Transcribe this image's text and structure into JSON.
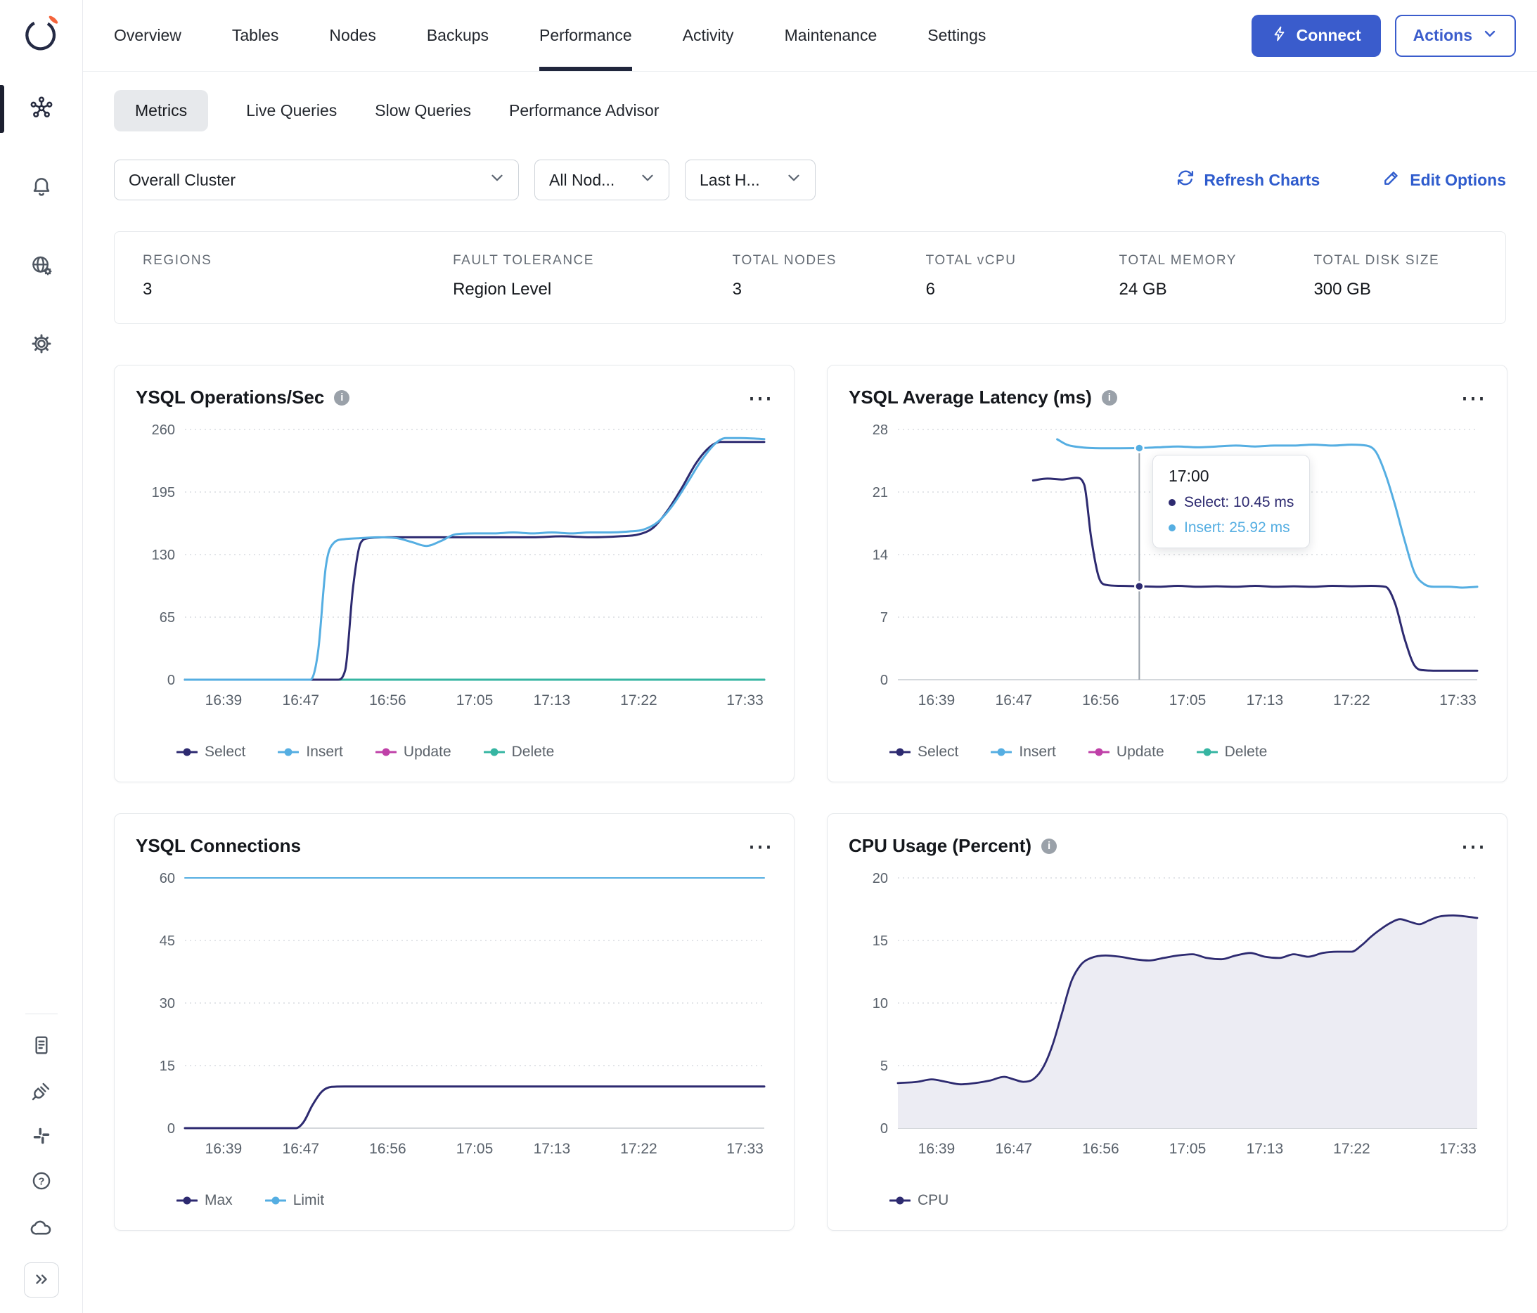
{
  "header": {
    "tabs": [
      {
        "label": "Overview",
        "active": false
      },
      {
        "label": "Tables",
        "active": false
      },
      {
        "label": "Nodes",
        "active": false
      },
      {
        "label": "Backups",
        "active": false
      },
      {
        "label": "Performance",
        "active": true
      },
      {
        "label": "Activity",
        "active": false
      },
      {
        "label": "Maintenance",
        "active": false
      },
      {
        "label": "Settings",
        "active": false
      }
    ],
    "connect_label": "Connect",
    "actions_label": "Actions"
  },
  "subtabs": [
    {
      "label": "Metrics",
      "active": true
    },
    {
      "label": "Live Queries",
      "active": false
    },
    {
      "label": "Slow Queries",
      "active": false
    },
    {
      "label": "Performance Advisor",
      "active": false
    }
  ],
  "filters": {
    "cluster": "Overall Cluster",
    "nodes": "All Nod...",
    "range": "Last H...",
    "refresh_label": "Refresh Charts",
    "edit_label": "Edit Options"
  },
  "stats": [
    {
      "label": "REGIONS",
      "value": "3"
    },
    {
      "label": "FAULT TOLERANCE",
      "value": "Region Level"
    },
    {
      "label": "TOTAL NODES",
      "value": "3"
    },
    {
      "label": "TOTAL vCPU",
      "value": "6"
    },
    {
      "label": "TOTAL MEMORY",
      "value": "24 GB"
    },
    {
      "label": "TOTAL DISK SIZE",
      "value": "300 GB"
    }
  ],
  "sidebar": {
    "icons": [
      "yugabyte-logo",
      "cluster-icon",
      "alerts-bell-icon",
      "network-globe-icon",
      "settings-gear-icon",
      "docs-icon",
      "integrations-plug-icon",
      "slack-icon",
      "help-icon",
      "cloud-icon",
      "expand-chevrons-icon"
    ]
  },
  "colors": {
    "accent": "#3a5ccc",
    "select": "#2d2a70",
    "insert": "#55aee2",
    "update": "#bf40a8",
    "delete": "#36b5a2",
    "cpu_fill": "#ececf3"
  },
  "chart_data": [
    {
      "type": "line",
      "title": "YSQL Operations/Sec",
      "xdomain": [
        0,
        60
      ],
      "xticks": [
        {
          "t": 4,
          "label": "16:39"
        },
        {
          "t": 12,
          "label": "16:47"
        },
        {
          "t": 21,
          "label": "16:56"
        },
        {
          "t": 30,
          "label": "17:05"
        },
        {
          "t": 38,
          "label": "17:13"
        },
        {
          "t": 47,
          "label": "17:22"
        },
        {
          "t": 58,
          "label": "17:33"
        }
      ],
      "yticks": [
        0,
        65,
        130,
        195,
        260
      ],
      "ymax": 260,
      "legend": [
        {
          "label": "Select",
          "color": "#2d2a70"
        },
        {
          "label": "Insert",
          "color": "#55aee2"
        },
        {
          "label": "Update",
          "color": "#bf40a8"
        },
        {
          "label": "Delete",
          "color": "#36b5a2"
        }
      ],
      "series": [
        {
          "name": "Update",
          "color": "#bf40a8",
          "width": 3,
          "points": [
            [
              0,
              0
            ],
            [
              60,
              0
            ]
          ]
        },
        {
          "name": "Delete",
          "color": "#36b5a2",
          "width": 3,
          "points": [
            [
              0,
              0
            ],
            [
              60,
              0
            ]
          ]
        },
        {
          "name": "Select",
          "color": "#2d2a70",
          "width": 3,
          "points": [
            [
              0,
              0
            ],
            [
              15.8,
              0
            ],
            [
              16.6,
              10
            ],
            [
              17.4,
              95
            ],
            [
              18.2,
              142
            ],
            [
              19,
              147
            ],
            [
              21,
              148
            ],
            [
              24,
              148
            ],
            [
              27,
              148
            ],
            [
              30,
              148
            ],
            [
              33,
              148
            ],
            [
              36,
              148
            ],
            [
              39,
              149
            ],
            [
              42,
              148
            ],
            [
              45,
              149
            ],
            [
              47,
              151
            ],
            [
              48.5,
              158
            ],
            [
              50,
              176
            ],
            [
              51.5,
              200
            ],
            [
              53,
              226
            ],
            [
              54.5,
              243
            ],
            [
              55.5,
              247
            ],
            [
              57,
              247
            ],
            [
              60,
              247
            ]
          ]
        },
        {
          "name": "Insert",
          "color": "#55aee2",
          "width": 3,
          "points": [
            [
              0,
              0
            ],
            [
              13,
              0
            ],
            [
              13.8,
              30
            ],
            [
              14.6,
              118
            ],
            [
              15.4,
              142
            ],
            [
              16.5,
              146
            ],
            [
              18,
              147
            ],
            [
              20,
              148
            ],
            [
              22,
              147
            ],
            [
              23.5,
              143
            ],
            [
              25,
              139
            ],
            [
              26.5,
              144
            ],
            [
              28,
              151
            ],
            [
              30,
              152
            ],
            [
              32,
              152
            ],
            [
              34,
              153
            ],
            [
              36,
              152
            ],
            [
              38,
              153
            ],
            [
              40,
              152
            ],
            [
              42,
              153
            ],
            [
              44,
              153
            ],
            [
              46,
              154
            ],
            [
              47.5,
              156
            ],
            [
              49,
              164
            ],
            [
              50.5,
              181
            ],
            [
              52,
              204
            ],
            [
              53.5,
              228
            ],
            [
              55,
              246
            ],
            [
              56,
              251
            ],
            [
              57.5,
              251
            ],
            [
              60,
              250
            ]
          ]
        }
      ]
    },
    {
      "type": "line",
      "title": "YSQL Average Latency (ms)",
      "xdomain": [
        0,
        60
      ],
      "xticks": [
        {
          "t": 4,
          "label": "16:39"
        },
        {
          "t": 12,
          "label": "16:47"
        },
        {
          "t": 21,
          "label": "16:56"
        },
        {
          "t": 30,
          "label": "17:05"
        },
        {
          "t": 38,
          "label": "17:13"
        },
        {
          "t": 47,
          "label": "17:22"
        },
        {
          "t": 58,
          "label": "17:33"
        }
      ],
      "yticks": [
        0,
        7,
        14,
        21,
        28
      ],
      "ymax": 28,
      "legend": [
        {
          "label": "Select",
          "color": "#2d2a70"
        },
        {
          "label": "Insert",
          "color": "#55aee2"
        },
        {
          "label": "Update",
          "color": "#bf40a8"
        },
        {
          "label": "Delete",
          "color": "#36b5a2"
        }
      ],
      "series": [
        {
          "name": "Select",
          "color": "#2d2a70",
          "width": 3,
          "points": [
            [
              14,
              22.3
            ],
            [
              15.5,
              22.5
            ],
            [
              17,
              22.4
            ],
            [
              18.5,
              22.6
            ],
            [
              19.3,
              21.8
            ],
            [
              20,
              16
            ],
            [
              20.8,
              11.5
            ],
            [
              21.6,
              10.6
            ],
            [
              23,
              10.5
            ],
            [
              25,
              10.45
            ],
            [
              27,
              10.4
            ],
            [
              29,
              10.5
            ],
            [
              31,
              10.4
            ],
            [
              33,
              10.45
            ],
            [
              35,
              10.4
            ],
            [
              37,
              10.5
            ],
            [
              39,
              10.4
            ],
            [
              41,
              10.45
            ],
            [
              43,
              10.4
            ],
            [
              45,
              10.5
            ],
            [
              47,
              10.45
            ],
            [
              49,
              10.5
            ],
            [
              50.5,
              10.4
            ],
            [
              51.5,
              8.5
            ],
            [
              52.5,
              4.5
            ],
            [
              53.5,
              1.6
            ],
            [
              54.5,
              1.05
            ],
            [
              56,
              1.0
            ],
            [
              58,
              1.0
            ],
            [
              60,
              1.0
            ]
          ]
        },
        {
          "name": "Insert",
          "color": "#55aee2",
          "width": 3,
          "points": [
            [
              16.5,
              26.9
            ],
            [
              17.5,
              26.3
            ],
            [
              19,
              26.0
            ],
            [
              21,
              25.9
            ],
            [
              23,
              25.9
            ],
            [
              25,
              25.92
            ],
            [
              27,
              26.0
            ],
            [
              29,
              26.1
            ],
            [
              31,
              26.0
            ],
            [
              33,
              26.1
            ],
            [
              35,
              26.2
            ],
            [
              37,
              26.1
            ],
            [
              39,
              26.2
            ],
            [
              41,
              26.2
            ],
            [
              43,
              26.3
            ],
            [
              45,
              26.2
            ],
            [
              47,
              26.3
            ],
            [
              48.5,
              26.2
            ],
            [
              49.5,
              25.5
            ],
            [
              50.5,
              23
            ],
            [
              51.5,
              19.5
            ],
            [
              52.5,
              15.5
            ],
            [
              53.5,
              12
            ],
            [
              54.5,
              10.7
            ],
            [
              55.5,
              10.4
            ],
            [
              57,
              10.4
            ],
            [
              58.5,
              10.3
            ],
            [
              60,
              10.4
            ]
          ]
        }
      ],
      "tooltip": {
        "t": 25,
        "time_label": "17:00",
        "rows": [
          {
            "label": "Select: 10.45 ms",
            "y": 10.45,
            "color": "#2d2a70"
          },
          {
            "label": "Insert: 25.92 ms",
            "y": 25.92,
            "color": "#55aee2"
          }
        ]
      }
    },
    {
      "type": "line",
      "title": "YSQL Connections",
      "xdomain": [
        0,
        60
      ],
      "xticks": [
        {
          "t": 4,
          "label": "16:39"
        },
        {
          "t": 12,
          "label": "16:47"
        },
        {
          "t": 21,
          "label": "16:56"
        },
        {
          "t": 30,
          "label": "17:05"
        },
        {
          "t": 38,
          "label": "17:13"
        },
        {
          "t": 47,
          "label": "17:22"
        },
        {
          "t": 58,
          "label": "17:33"
        }
      ],
      "yticks": [
        0,
        15,
        30,
        45,
        60
      ],
      "ymax": 60,
      "legend": [
        {
          "label": "Max",
          "color": "#2d2a70"
        },
        {
          "label": "Limit",
          "color": "#55aee2"
        }
      ],
      "series": [
        {
          "name": "Limit",
          "color": "#55aee2",
          "width": 2,
          "points": [
            [
              0,
              60
            ],
            [
              60,
              60
            ]
          ]
        },
        {
          "name": "Max",
          "color": "#2d2a70",
          "width": 3,
          "points": [
            [
              0,
              0
            ],
            [
              11.5,
              0
            ],
            [
              12.3,
              1.5
            ],
            [
              13.2,
              5.5
            ],
            [
              14.2,
              8.8
            ],
            [
              15.2,
              9.9
            ],
            [
              16.5,
              10
            ],
            [
              20,
              10
            ],
            [
              25,
              10
            ],
            [
              30,
              10
            ],
            [
              35,
              10
            ],
            [
              40,
              10
            ],
            [
              45,
              10
            ],
            [
              50,
              10
            ],
            [
              55,
              10
            ],
            [
              60,
              10
            ]
          ]
        }
      ]
    },
    {
      "type": "area",
      "title": "CPU Usage (Percent)",
      "xdomain": [
        0,
        60
      ],
      "xticks": [
        {
          "t": 4,
          "label": "16:39"
        },
        {
          "t": 12,
          "label": "16:47"
        },
        {
          "t": 21,
          "label": "16:56"
        },
        {
          "t": 30,
          "label": "17:05"
        },
        {
          "t": 38,
          "label": "17:13"
        },
        {
          "t": 47,
          "label": "17:22"
        },
        {
          "t": 58,
          "label": "17:33"
        }
      ],
      "yticks": [
        0,
        5,
        10,
        15,
        20
      ],
      "ymax": 20,
      "legend": [
        {
          "label": "CPU",
          "color": "#2d2a70"
        }
      ],
      "series": [
        {
          "name": "CPU",
          "color": "#2d2a70",
          "width": 2.8,
          "fill": "#ececf3",
          "points": [
            [
              0,
              3.6
            ],
            [
              2,
              3.7
            ],
            [
              3.5,
              3.9
            ],
            [
              5,
              3.7
            ],
            [
              6.5,
              3.5
            ],
            [
              8,
              3.6
            ],
            [
              9.5,
              3.8
            ],
            [
              11,
              4.1
            ],
            [
              12,
              3.9
            ],
            [
              13,
              3.7
            ],
            [
              14,
              3.9
            ],
            [
              15,
              4.8
            ],
            [
              16,
              6.6
            ],
            [
              17,
              9.2
            ],
            [
              18,
              11.8
            ],
            [
              19,
              13.1
            ],
            [
              20,
              13.6
            ],
            [
              21.5,
              13.8
            ],
            [
              23,
              13.7
            ],
            [
              24.5,
              13.5
            ],
            [
              26,
              13.4
            ],
            [
              27.5,
              13.6
            ],
            [
              29,
              13.8
            ],
            [
              30.5,
              13.9
            ],
            [
              32,
              13.6
            ],
            [
              33.5,
              13.5
            ],
            [
              35,
              13.8
            ],
            [
              36.5,
              14.0
            ],
            [
              38,
              13.7
            ],
            [
              39.5,
              13.6
            ],
            [
              41,
              13.9
            ],
            [
              42.5,
              13.7
            ],
            [
              44,
              14.0
            ],
            [
              45.5,
              14.1
            ],
            [
              47,
              14.1
            ],
            [
              48,
              14.6
            ],
            [
              49,
              15.3
            ],
            [
              50,
              15.9
            ],
            [
              51,
              16.4
            ],
            [
              52,
              16.7
            ],
            [
              53,
              16.5
            ],
            [
              54,
              16.3
            ],
            [
              55,
              16.6
            ],
            [
              56,
              16.9
            ],
            [
              57.5,
              17.0
            ],
            [
              59,
              16.9
            ],
            [
              60,
              16.8
            ]
          ]
        }
      ]
    }
  ]
}
